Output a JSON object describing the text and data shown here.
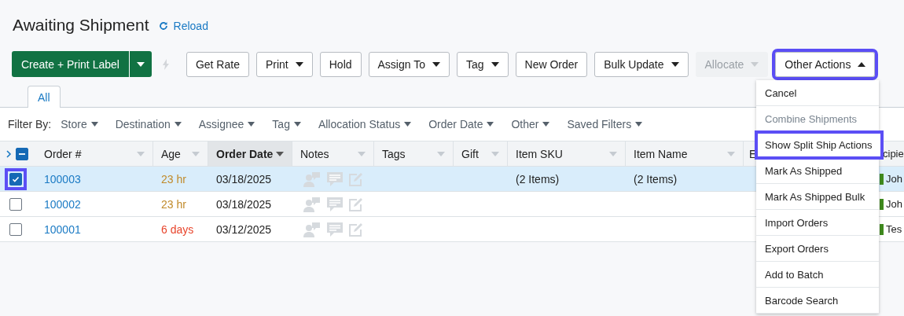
{
  "page": {
    "title": "Awaiting Shipment",
    "reload": "Reload"
  },
  "toolbar": {
    "primary": {
      "label": "Create + Print Label"
    },
    "buttons": [
      {
        "label": "Get Rate",
        "dropdown": false,
        "disabled": false,
        "highlighted": false
      },
      {
        "label": "Print",
        "dropdown": true,
        "disabled": false,
        "highlighted": false
      },
      {
        "label": "Hold",
        "dropdown": false,
        "disabled": false,
        "highlighted": false
      },
      {
        "label": "Assign To",
        "dropdown": true,
        "disabled": false,
        "highlighted": false
      },
      {
        "label": "Tag",
        "dropdown": true,
        "disabled": false,
        "highlighted": false
      },
      {
        "label": "New Order",
        "dropdown": false,
        "disabled": false,
        "highlighted": false
      },
      {
        "label": "Bulk Update",
        "dropdown": true,
        "disabled": false,
        "highlighted": false
      },
      {
        "label": "Allocate",
        "dropdown": true,
        "disabled": true,
        "highlighted": false
      },
      {
        "label": "Other Actions",
        "dropdown": true,
        "disabled": false,
        "highlighted": true,
        "expanded": true
      }
    ]
  },
  "tabs": [
    {
      "label": "All",
      "selected": true
    }
  ],
  "filters": {
    "label": "Filter By:",
    "items": [
      "Store",
      "Destination",
      "Assignee",
      "Tag",
      "Allocation Status",
      "Order Date",
      "Other",
      "Saved Filters"
    ]
  },
  "table": {
    "columns": [
      {
        "label": "Order #",
        "sorted": false
      },
      {
        "label": "Age",
        "sorted": false
      },
      {
        "label": "Order Date",
        "sorted": true
      },
      {
        "label": "Notes",
        "sorted": false
      },
      {
        "label": "Tags",
        "sorted": false
      },
      {
        "label": "Gift",
        "sorted": false
      },
      {
        "label": "Item SKU",
        "sorted": false
      },
      {
        "label": "Item Name",
        "sorted": false
      },
      {
        "label": "E",
        "sorted": false
      },
      {
        "label": "cipie",
        "sorted": false
      }
    ],
    "select_all_partial": true,
    "rows": [
      {
        "checked": true,
        "highlighted": true,
        "order": "100003",
        "age": "23 hr",
        "late": false,
        "date": "03/18/2025",
        "sku": "(2 Items)",
        "name": "(2 Items)",
        "recipient": "Joh"
      },
      {
        "checked": false,
        "highlighted": false,
        "order": "100002",
        "age": "23 hr",
        "late": false,
        "date": "03/18/2025",
        "recipient": "Joh"
      },
      {
        "checked": false,
        "highlighted": false,
        "order": "100001",
        "age": "6 days",
        "late": true,
        "date": "03/12/2025",
        "recipient": "Tes"
      }
    ]
  },
  "menu": {
    "items": [
      {
        "label": "Cancel",
        "disabled": false,
        "highlighted": false
      },
      {
        "label": "Combine Shipments",
        "disabled": true,
        "highlighted": false
      },
      {
        "label": "Show Split Ship Actions",
        "disabled": false,
        "highlighted": true
      },
      {
        "label": "Mark As Shipped",
        "disabled": false,
        "highlighted": false
      },
      {
        "label": "Mark As Shipped Bulk",
        "disabled": false,
        "highlighted": false
      },
      {
        "label": "Import Orders",
        "disabled": false,
        "highlighted": false
      },
      {
        "label": "Export Orders",
        "disabled": false,
        "highlighted": false
      },
      {
        "label": "Add to Batch",
        "disabled": false,
        "highlighted": false
      },
      {
        "label": "Barcode Search",
        "disabled": false,
        "highlighted": false
      }
    ]
  }
}
